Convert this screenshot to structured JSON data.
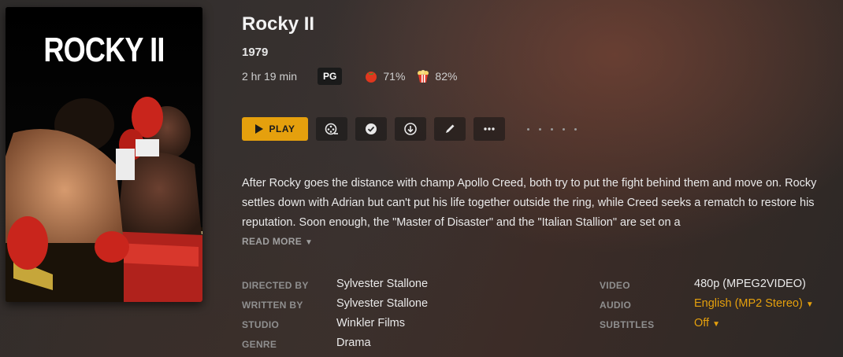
{
  "poster": {
    "title": "ROCKY II"
  },
  "movie": {
    "title": "Rocky II",
    "year": "1979",
    "duration": "2 hr 19 min",
    "content_rating": "PG",
    "critic_score": "71%",
    "audience_score": "82%"
  },
  "actions": {
    "play_label": "PLAY",
    "icons": [
      "trailer-icon",
      "watched-check-icon",
      "download-icon",
      "edit-pencil-icon",
      "more-icon"
    ]
  },
  "summary": {
    "text": "After Rocky goes the distance with champ Apollo Creed, both try to put the fight behind them and move on. Rocky settles down with Adrian but can't put his life together outside the ring, while Creed seeks a rematch to restore his reputation. Soon enough, the \"Master of Disaster\" and the \"Italian Stallion\" are set on a",
    "read_more": "READ MORE"
  },
  "details": {
    "directed_by_label": "DIRECTED BY",
    "directed_by": "Sylvester Stallone",
    "written_by_label": "WRITTEN BY",
    "written_by": "Sylvester Stallone",
    "studio_label": "STUDIO",
    "studio": "Winkler Films",
    "genre_label": "GENRE",
    "genre": "Drama",
    "video_label": "VIDEO",
    "video": "480p (MPEG2VIDEO)",
    "audio_label": "AUDIO",
    "audio": "English (MP2 Stereo)",
    "subtitles_label": "SUBTITLES",
    "subtitles": "Off"
  },
  "colors": {
    "accent": "#e5a00d",
    "background": "#332d2b"
  }
}
